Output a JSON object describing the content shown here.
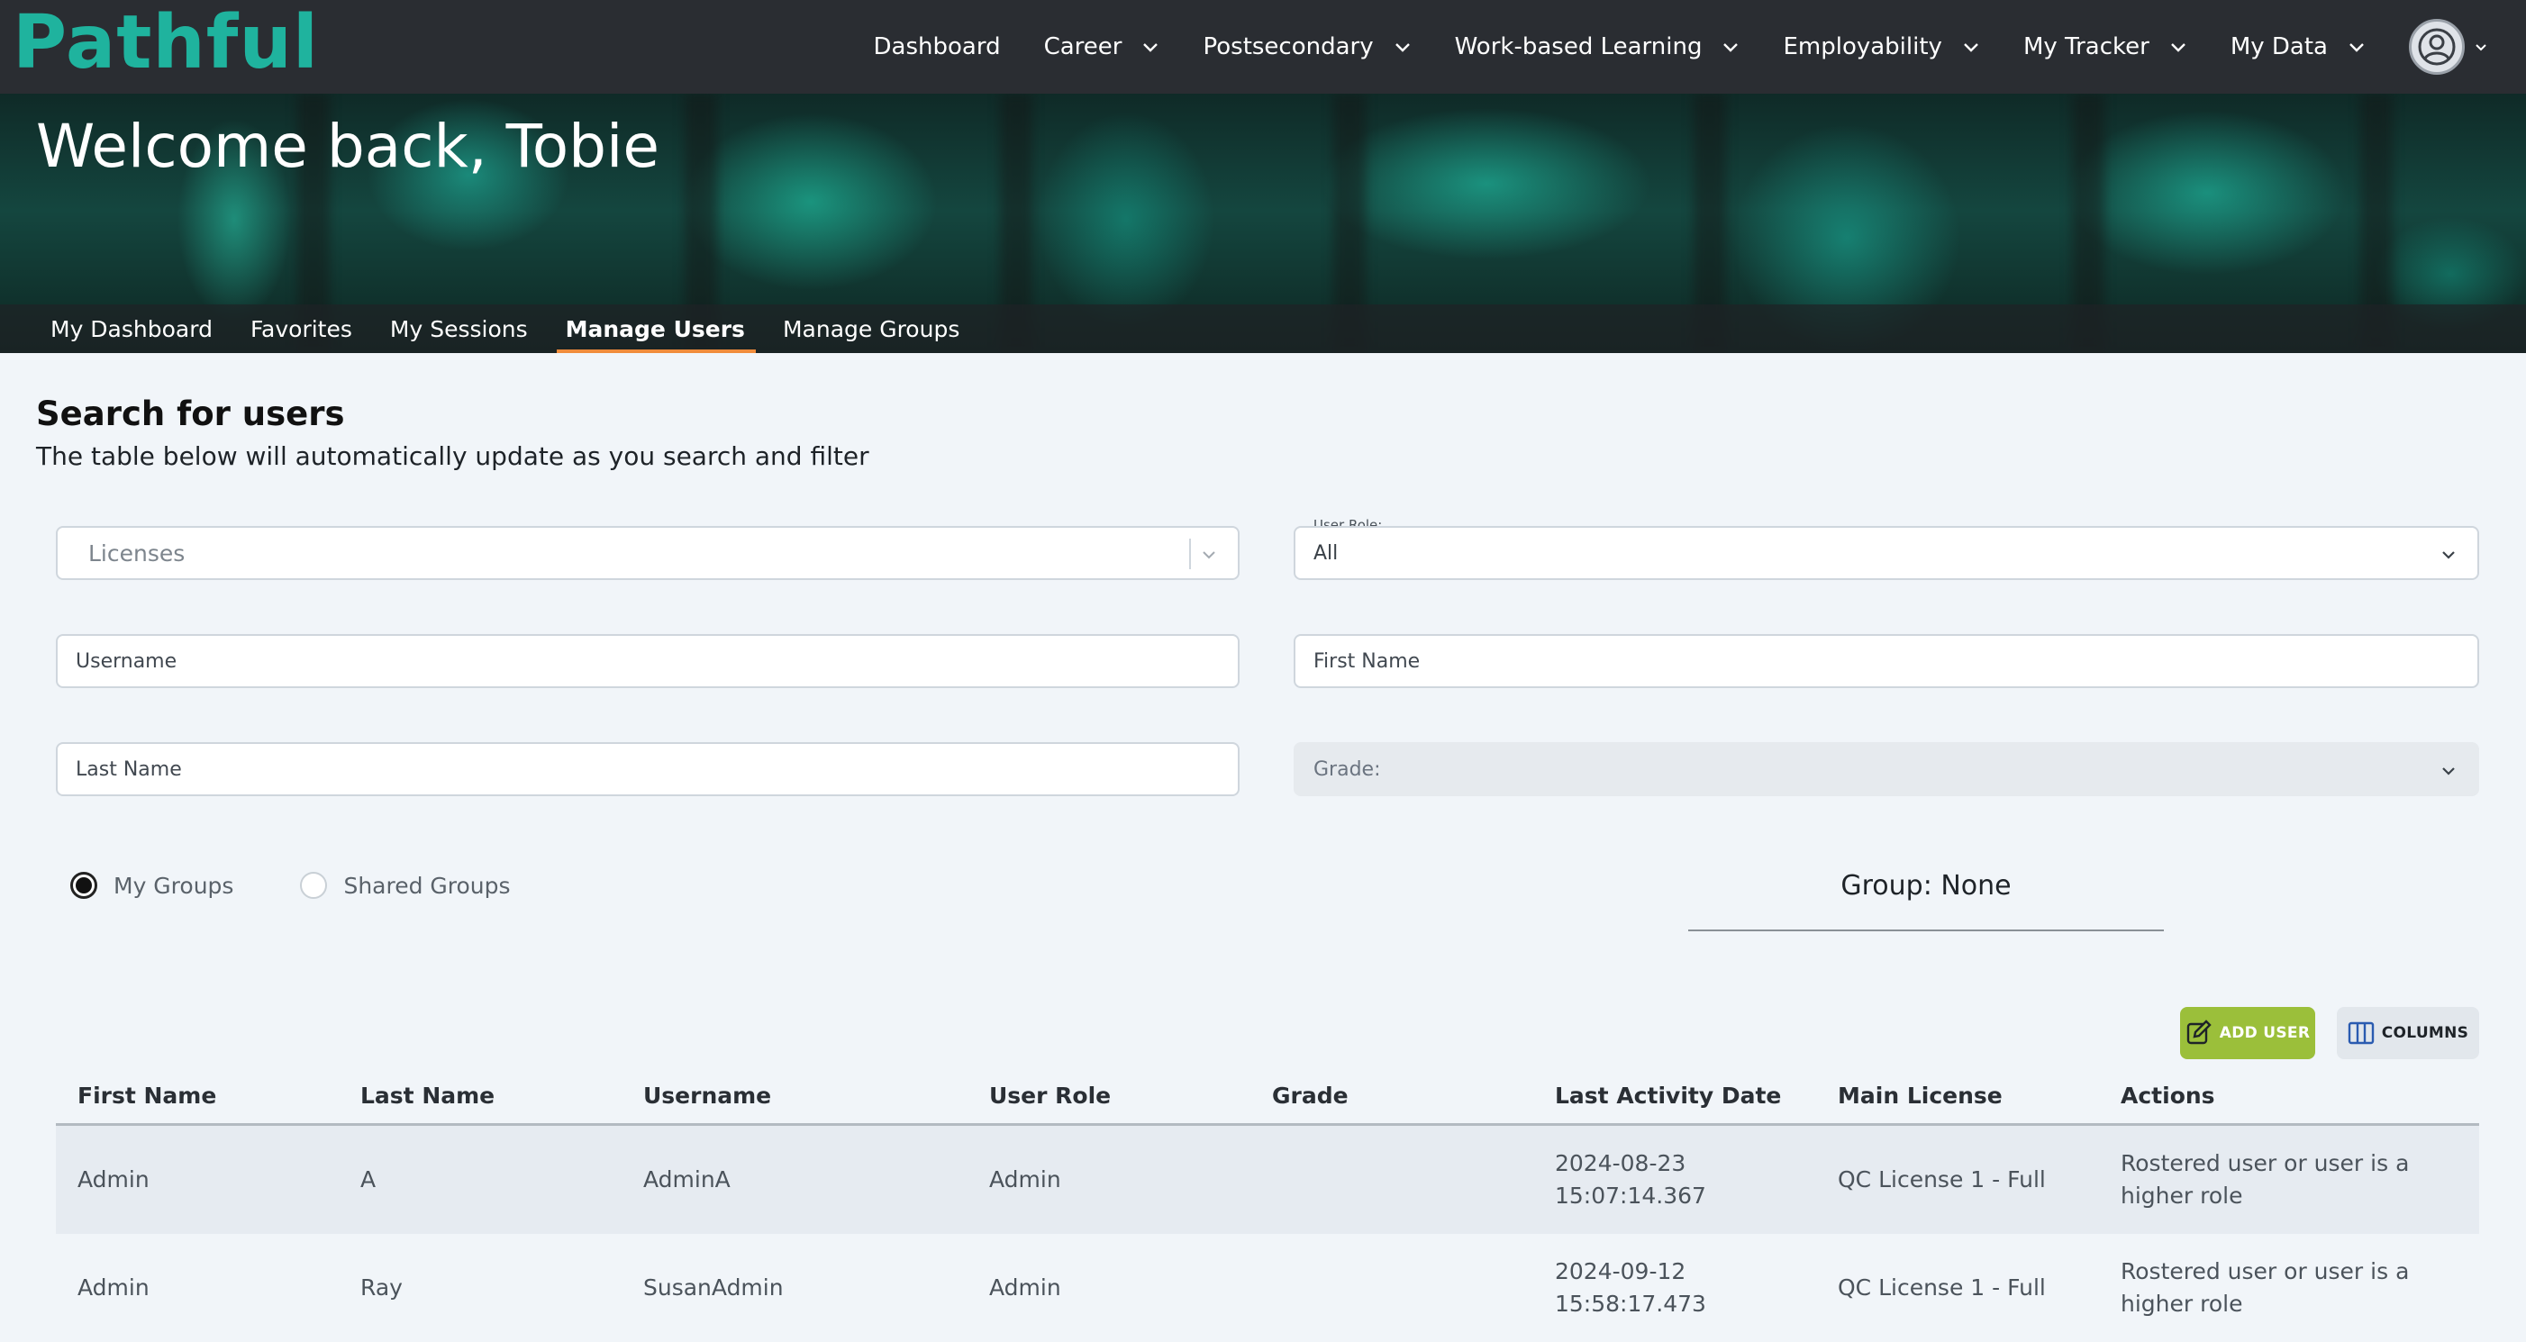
{
  "brand": {
    "name": "Pathful",
    "color": "#1fb39e"
  },
  "nav": {
    "items": [
      {
        "label": "Dashboard",
        "has_dropdown": false
      },
      {
        "label": "Career",
        "has_dropdown": true
      },
      {
        "label": "Postsecondary",
        "has_dropdown": true
      },
      {
        "label": "Work-based Learning",
        "has_dropdown": true
      },
      {
        "label": "Employability",
        "has_dropdown": true
      },
      {
        "label": "My Tracker",
        "has_dropdown": true
      },
      {
        "label": "My Data",
        "has_dropdown": true
      }
    ],
    "avatar_icon": "user-circle-icon"
  },
  "hero": {
    "title": "Welcome back, Tobie"
  },
  "subtabs": [
    {
      "label": "My Dashboard",
      "active": false
    },
    {
      "label": "Favorites",
      "active": false
    },
    {
      "label": "My Sessions",
      "active": false
    },
    {
      "label": "Manage Users",
      "active": true
    },
    {
      "label": "Manage Groups",
      "active": false
    }
  ],
  "search": {
    "title": "Search for users",
    "subtitle": "The table below will automatically update as you search and filter",
    "licenses_placeholder": "Licenses",
    "user_role_label": "User Role:",
    "user_role_value": "All",
    "username_placeholder": "Username",
    "first_name_placeholder": "First Name",
    "last_name_placeholder": "Last Name",
    "grade_placeholder": "Grade:"
  },
  "groups": {
    "my_groups_label": "My Groups",
    "shared_groups_label": "Shared Groups",
    "selected": "My Groups",
    "group_display": "Group: None"
  },
  "actions": {
    "add_user_label": "ADD USER",
    "columns_label": "COLUMNS",
    "add_user_color": "#9bbf3a"
  },
  "table": {
    "headers": [
      "First Name",
      "Last Name",
      "Username",
      "User Role",
      "Grade",
      "Last Activity Date",
      "Main License",
      "Actions"
    ],
    "rows": [
      {
        "first_name": "Admin",
        "last_name": "A",
        "username": "AdminA",
        "user_role": "Admin",
        "grade": "",
        "last_activity_date": "2024-08-23",
        "last_activity_time": "15:07:14.367",
        "main_license": "QC License 1 - Full",
        "actions_line1": "Rostered user or user is a",
        "actions_line2": "higher role"
      },
      {
        "first_name": "Admin",
        "last_name": "Ray",
        "username": "SusanAdmin",
        "user_role": "Admin",
        "grade": "",
        "last_activity_date": "2024-09-12",
        "last_activity_time": "15:58:17.473",
        "main_license": "QC License 1 - Full",
        "actions_line1": "Rostered user or user is a",
        "actions_line2": "higher role"
      }
    ]
  }
}
